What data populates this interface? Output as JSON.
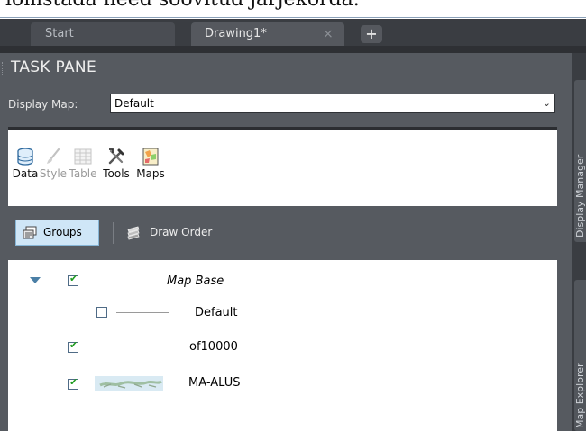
{
  "top_text": "lomstada need soovitud järjekorda.",
  "doc_tabs": [
    {
      "label": "Start"
    },
    {
      "label": "Drawing1*",
      "close": "×"
    }
  ],
  "add_tab": "+",
  "task_pane": {
    "title": "TASK PANE",
    "display_map": {
      "label": "Display Map:",
      "value": "Default",
      "arrow": "⌄"
    },
    "ribbon": [
      {
        "label": "Data",
        "enabled": true,
        "icon": "database-icon"
      },
      {
        "label": "Style",
        "enabled": false,
        "icon": "brush-icon"
      },
      {
        "label": "Table",
        "enabled": false,
        "icon": "table-icon"
      },
      {
        "label": "Tools",
        "enabled": true,
        "icon": "tools-icon"
      },
      {
        "label": "Maps",
        "enabled": true,
        "icon": "maps-icon"
      }
    ],
    "view_toggle": {
      "groups": "Groups",
      "draw_order": "Draw Order",
      "selected": "Groups"
    },
    "tree": [
      {
        "label": "Map Base",
        "checked": true,
        "expanded": true,
        "italic": true
      },
      {
        "label": "Default",
        "checked": false
      },
      {
        "label": "of10000",
        "checked": true
      },
      {
        "label": "MA-ALUS",
        "checked": true
      }
    ]
  },
  "side_tabs": [
    {
      "label": "Display Manager"
    },
    {
      "label": "Map Explorer"
    }
  ],
  "colors": {
    "accent": "#cfe6f7",
    "panel": "#565a60",
    "check": "#1e9b1e",
    "toggle": "#4b7fa6"
  }
}
